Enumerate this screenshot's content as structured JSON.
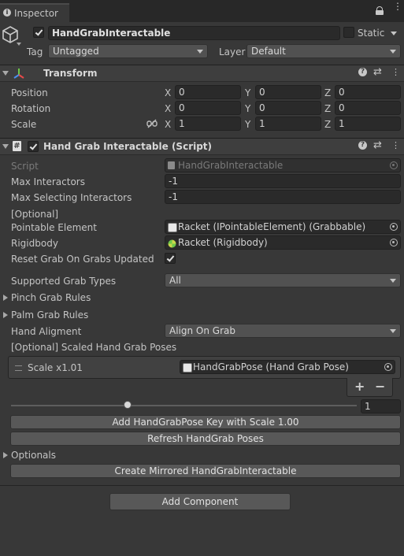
{
  "window": {
    "tab_label": "Inspector"
  },
  "gameobject": {
    "active": true,
    "name": "HandGrabInteractable",
    "static_label": "Static",
    "tag_label": "Tag",
    "tag_value": "Untagged",
    "layer_label": "Layer",
    "layer_value": "Default"
  },
  "transform": {
    "title": "Transform",
    "rows": [
      {
        "label": "Position",
        "x": "0",
        "y": "0",
        "z": "0"
      },
      {
        "label": "Rotation",
        "x": "0",
        "y": "0",
        "z": "0"
      },
      {
        "label": "Scale",
        "x": "1",
        "y": "1",
        "z": "1"
      }
    ],
    "axis": {
      "x": "X",
      "y": "Y",
      "z": "Z"
    }
  },
  "script_component": {
    "title": "Hand Grab Interactable (Script)",
    "enabled": true,
    "script_label": "Script",
    "script_value": "HandGrabInteractable",
    "max_interactors_label": "Max Interactors",
    "max_interactors_value": "-1",
    "max_selecting_label": "Max Selecting Interactors",
    "max_selecting_value": "-1",
    "optional_header": "[Optional]",
    "pointable_label": "Pointable Element",
    "pointable_value": "Racket (IPointableElement) (Grabbable)",
    "rigidbody_label": "Rigidbody",
    "rigidbody_value": "Racket (Rigidbody)",
    "reset_grab_label": "Reset Grab On Grabs Updated",
    "reset_grab_checked": true,
    "supported_grab_label": "Supported Grab Types",
    "supported_grab_value": "All",
    "pinch_rules_label": "Pinch Grab Rules",
    "palm_rules_label": "Palm Grab Rules",
    "hand_alignment_label": "Hand Aligment",
    "hand_alignment_value": "Align On Grab",
    "scaled_poses_label": "[Optional] Scaled Hand Grab Poses",
    "pose_item_label": "Scale x1.01",
    "pose_item_value": "HandGrabPose (Hand Grab Pose)",
    "add_symbol": "+",
    "remove_symbol": "−",
    "slider_value": "1",
    "add_pose_button": "Add HandGrabPose Key with Scale 1.00",
    "refresh_button": "Refresh HandGrab Poses",
    "optionals_label": "Optionals",
    "mirror_button": "Create Mirrored HandGrabInteractable"
  },
  "add_component_button": "Add Component",
  "colors": {
    "background": "#383838",
    "field": "#2a2a2a",
    "header": "#3e3e3e",
    "button": "#585858"
  }
}
